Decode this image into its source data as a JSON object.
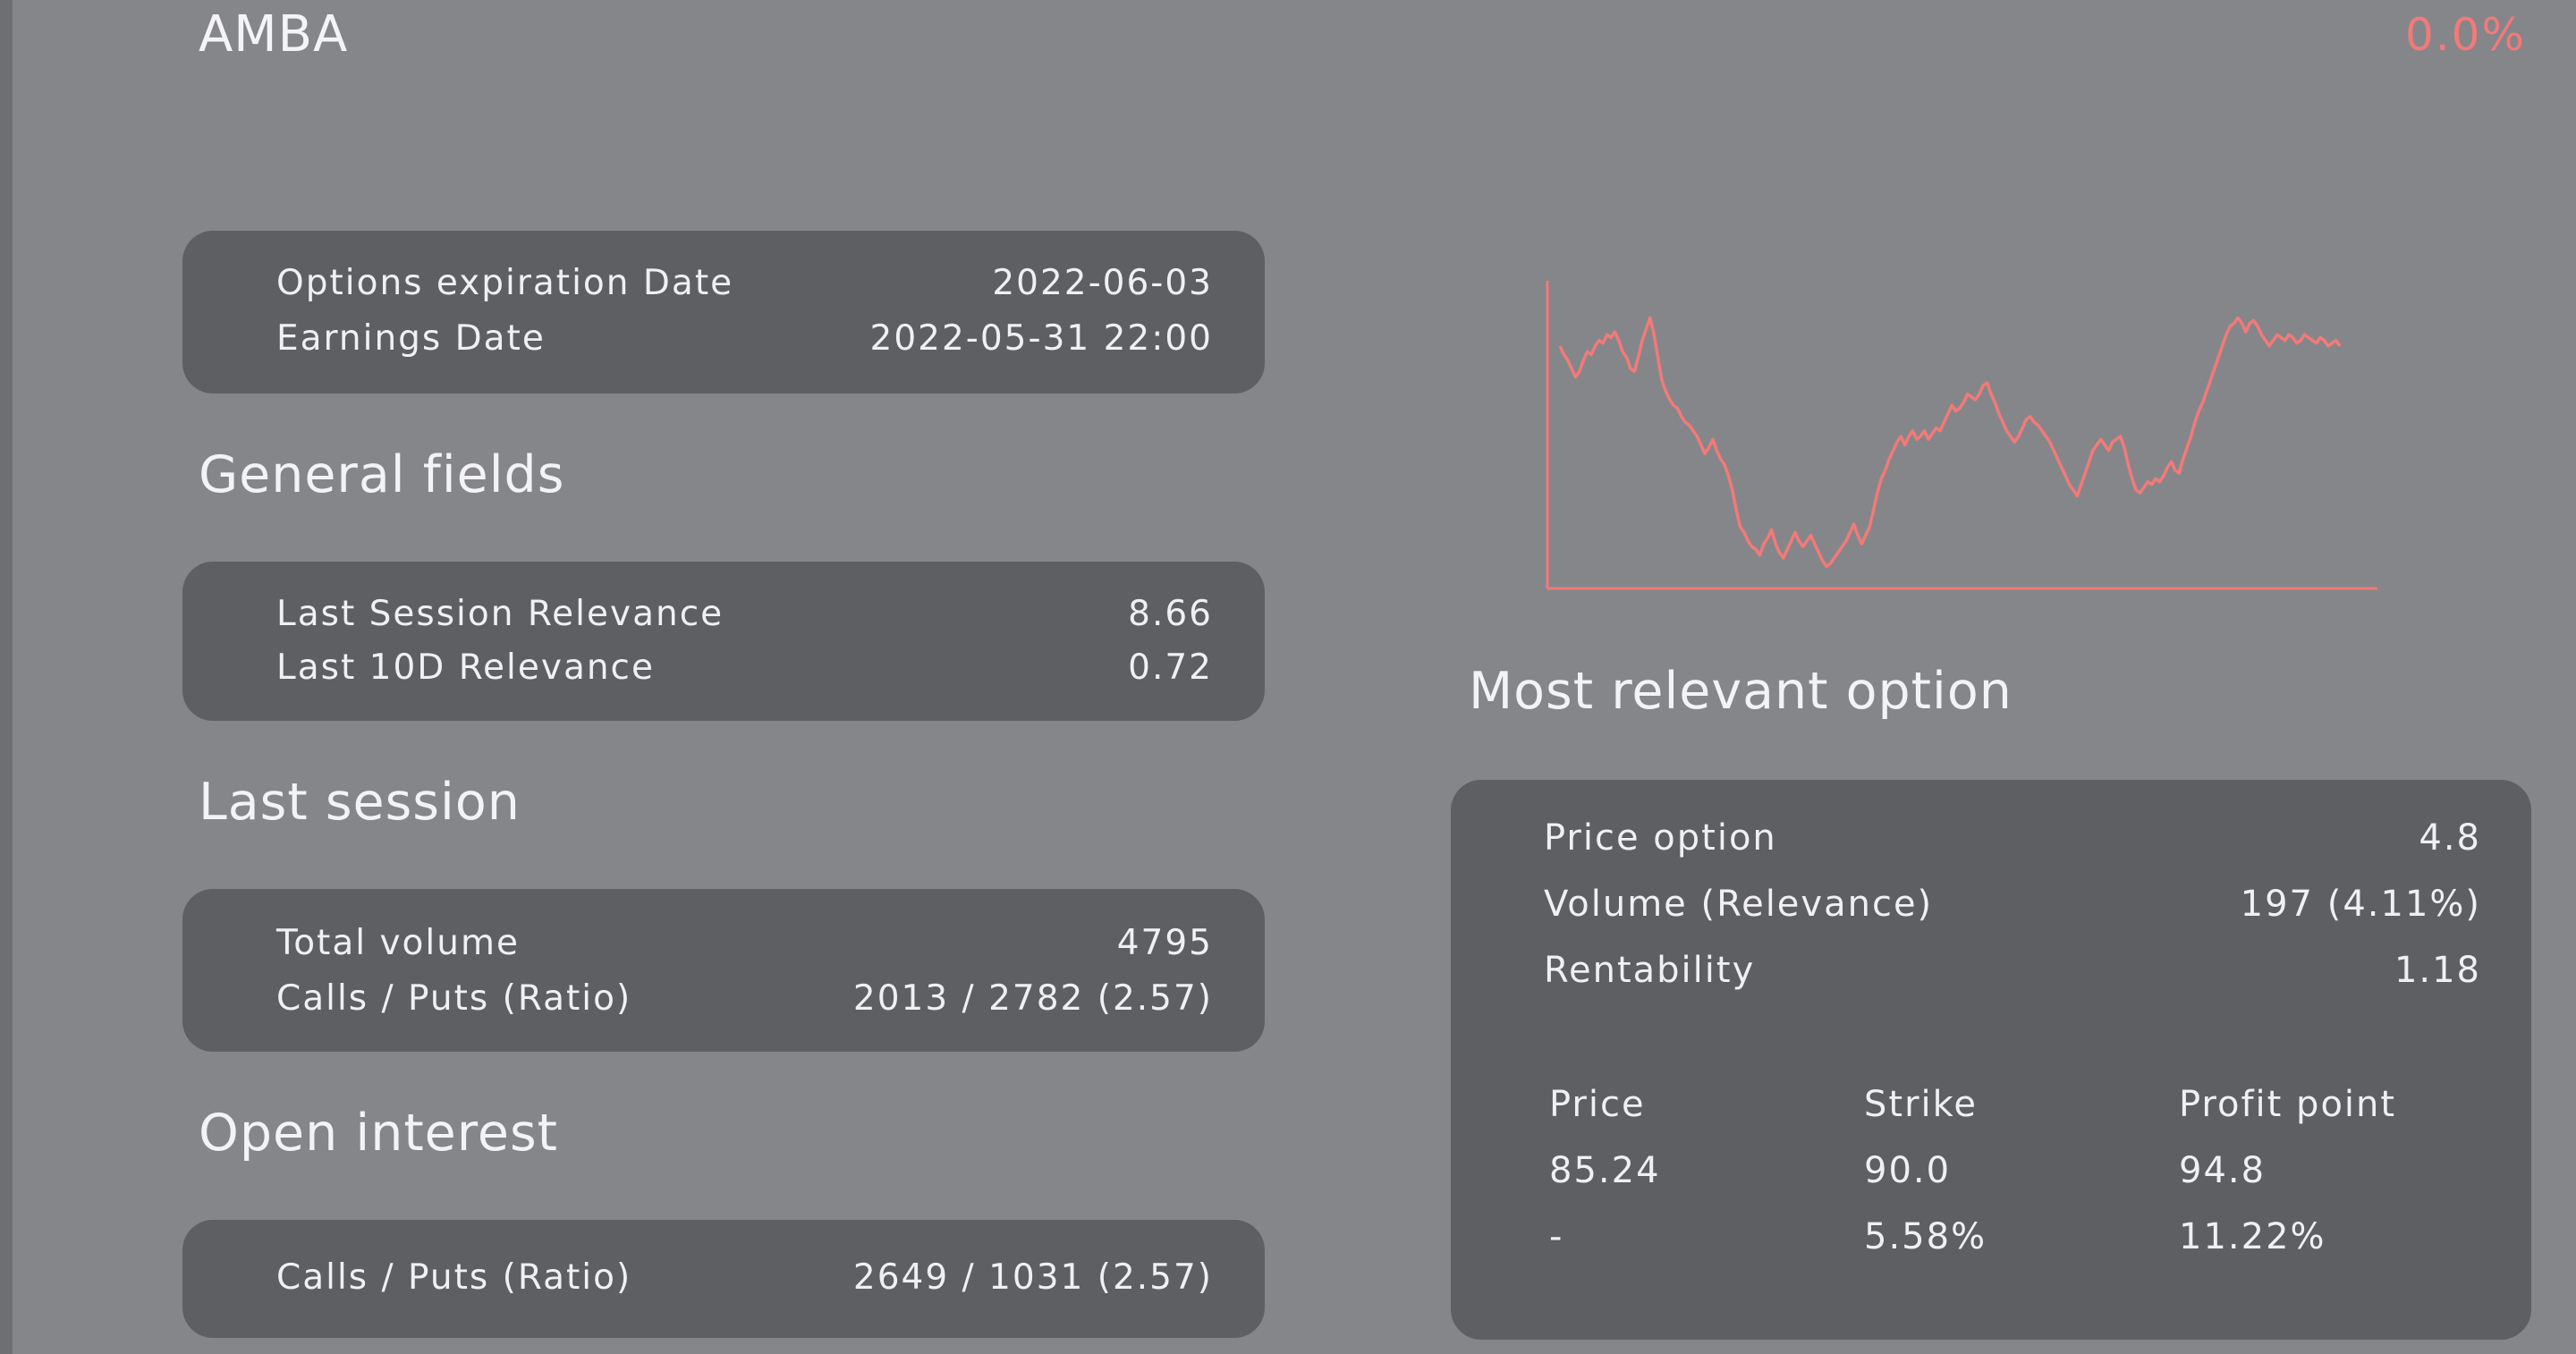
{
  "header": {
    "ticker": "AMBA",
    "change": "0.0%"
  },
  "dates_card": {
    "rows": [
      {
        "label": "Options expiration Date",
        "value": "2022-06-03"
      },
      {
        "label": "Earnings Date",
        "value": "2022-05-31 22:00"
      }
    ]
  },
  "general_fields": {
    "title": "General fields",
    "rows": [
      {
        "label": "Last Session Relevance",
        "value": "8.66"
      },
      {
        "label": "Last 10D Relevance",
        "value": "0.72"
      }
    ]
  },
  "last_session": {
    "title": "Last session",
    "rows": [
      {
        "label": "Total volume",
        "value": "4795"
      },
      {
        "label": "Calls / Puts (Ratio)",
        "value": "2013 / 2782 (2.57)"
      }
    ]
  },
  "open_interest": {
    "title": "Open interest",
    "rows": [
      {
        "label": "Calls / Puts (Ratio)",
        "value": "2649 / 1031 (2.57)"
      }
    ]
  },
  "most_relevant_option": {
    "title": "Most relevant option",
    "rows": [
      {
        "label": "Price option",
        "value": "4.8"
      },
      {
        "label": "Volume (Relevance)",
        "value": "197 (4.11%)"
      },
      {
        "label": "Rentability",
        "value": "1.18"
      }
    ],
    "table": {
      "headers": [
        "Price",
        "Strike",
        "Profit point"
      ],
      "rows": [
        [
          "85.24",
          "90.0",
          "94.8"
        ],
        [
          "-",
          "5.58%",
          "11.22%"
        ]
      ]
    }
  },
  "colors": {
    "background": "#85868a",
    "card": "#5e5f63",
    "text": "#f0f0f2",
    "accent": "#f27a78"
  },
  "chart_data": {
    "type": "line",
    "x": [
      0,
      1,
      2,
      3,
      4,
      5,
      6,
      7,
      8,
      9,
      10,
      11,
      12,
      13,
      14,
      15,
      16,
      17,
      18,
      19,
      20,
      21,
      22,
      23,
      24,
      25,
      26,
      27,
      28,
      29,
      30,
      31,
      32,
      33,
      34,
      35,
      36,
      37,
      38,
      39,
      40,
      41,
      42,
      43,
      44,
      45,
      46,
      47,
      48,
      49,
      50,
      51,
      52,
      53,
      54,
      55,
      56,
      57,
      58,
      59,
      60,
      61,
      62,
      63,
      64,
      65,
      66,
      67,
      68,
      69,
      70,
      71,
      72,
      73,
      74,
      75,
      76,
      77,
      78,
      79,
      80,
      81,
      82,
      83,
      84,
      85,
      86,
      87,
      88,
      89,
      90,
      91,
      92,
      93,
      94,
      95,
      96,
      97,
      98,
      99,
      100,
      101,
      102,
      103,
      104,
      105,
      106,
      107,
      108,
      109,
      110,
      111,
      112,
      113,
      114,
      115,
      116,
      117,
      118,
      119,
      120,
      121,
      122,
      123,
      124,
      125,
      126,
      127,
      128,
      129,
      130,
      131,
      132,
      133,
      134,
      135,
      136,
      137,
      138,
      139,
      140,
      141,
      142,
      143,
      144,
      145,
      146,
      147,
      148,
      149,
      150,
      151,
      152,
      153,
      154,
      155,
      156,
      157,
      158,
      159,
      160,
      161,
      162,
      163,
      164,
      165,
      166,
      167,
      168,
      169,
      170,
      171,
      172,
      173,
      174,
      175,
      176,
      177,
      178,
      179,
      180,
      181,
      182,
      183,
      184,
      185,
      186,
      187,
      188,
      189,
      190,
      191,
      192,
      193,
      194,
      195,
      196,
      197,
      198,
      199
    ],
    "series": [
      {
        "values": [
          0.82,
          0.79,
          0.77,
          0.74,
          0.71,
          0.73,
          0.77,
          0.8,
          0.79,
          0.82,
          0.84,
          0.83,
          0.86,
          0.85,
          0.87,
          0.84,
          0.8,
          0.78,
          0.74,
          0.73,
          0.78,
          0.84,
          0.88,
          0.92,
          0.86,
          0.78,
          0.7,
          0.66,
          0.63,
          0.61,
          0.6,
          0.57,
          0.55,
          0.54,
          0.52,
          0.5,
          0.47,
          0.44,
          0.46,
          0.49,
          0.45,
          0.42,
          0.4,
          0.36,
          0.31,
          0.24,
          0.18,
          0.16,
          0.13,
          0.11,
          0.1,
          0.08,
          0.12,
          0.14,
          0.17,
          0.12,
          0.09,
          0.07,
          0.1,
          0.13,
          0.16,
          0.13,
          0.11,
          0.13,
          0.15,
          0.12,
          0.09,
          0.06,
          0.04,
          0.05,
          0.07,
          0.09,
          0.11,
          0.13,
          0.16,
          0.19,
          0.15,
          0.12,
          0.15,
          0.18,
          0.24,
          0.3,
          0.35,
          0.38,
          0.42,
          0.45,
          0.48,
          0.5,
          0.47,
          0.5,
          0.52,
          0.49,
          0.5,
          0.52,
          0.49,
          0.51,
          0.53,
          0.52,
          0.55,
          0.58,
          0.61,
          0.59,
          0.6,
          0.62,
          0.65,
          0.64,
          0.63,
          0.65,
          0.68,
          0.69,
          0.65,
          0.62,
          0.58,
          0.55,
          0.52,
          0.5,
          0.48,
          0.5,
          0.53,
          0.56,
          0.57,
          0.55,
          0.54,
          0.52,
          0.5,
          0.48,
          0.45,
          0.42,
          0.39,
          0.36,
          0.33,
          0.31,
          0.29,
          0.33,
          0.37,
          0.41,
          0.45,
          0.47,
          0.49,
          0.47,
          0.45,
          0.48,
          0.49,
          0.5,
          0.46,
          0.4,
          0.35,
          0.31,
          0.3,
          0.32,
          0.34,
          0.33,
          0.35,
          0.34,
          0.36,
          0.39,
          0.41,
          0.38,
          0.37,
          0.42,
          0.46,
          0.5,
          0.55,
          0.59,
          0.62,
          0.66,
          0.7,
          0.74,
          0.78,
          0.82,
          0.86,
          0.89,
          0.9,
          0.92,
          0.9,
          0.87,
          0.9,
          0.91,
          0.89,
          0.86,
          0.84,
          0.82,
          0.84,
          0.86,
          0.85,
          0.84,
          0.86,
          0.85,
          0.83,
          0.84,
          0.86,
          0.85,
          0.84,
          0.83,
          0.85,
          0.84,
          0.82,
          0.83,
          0.84,
          0.82
        ],
        "color": "#f27a78"
      }
    ],
    "grid": false,
    "legend": false
  }
}
